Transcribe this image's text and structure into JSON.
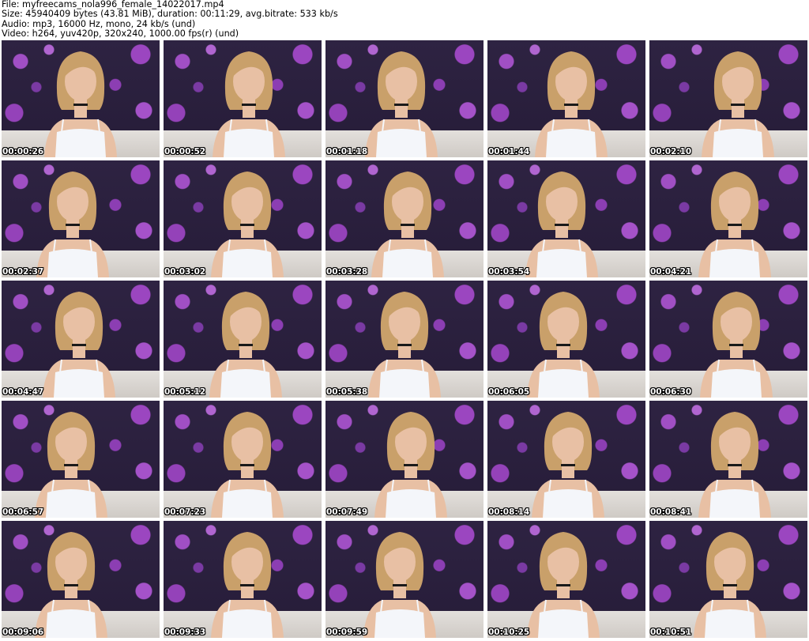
{
  "header": {
    "file_line": "File: myfreecams_nola996_female_14022017.mp4",
    "size_line": "Size: 45940409 bytes (43.81 MiB), duration: 00:11:29, avg.bitrate: 533 kb/s",
    "audio_line": "Audio: mp3, 16000 Hz, mono, 24 kb/s (und)",
    "video_line": "Video: h264, yuv420p, 320x240, 1000.00 fps(r) (und)"
  },
  "colors": {
    "wallpaper_base": "#2b2140",
    "flower_purple": "#a04fc4",
    "couch": "#dcd8d4",
    "top_white": "#f4f6fa",
    "hair": "#c9a06a",
    "skin": "#e8c0a4",
    "timestamp_text": "#ffffff"
  },
  "thumbnails": [
    {
      "time": "00:00:26"
    },
    {
      "time": "00:00:52"
    },
    {
      "time": "00:01:18"
    },
    {
      "time": "00:01:44"
    },
    {
      "time": "00:02:10"
    },
    {
      "time": "00:02:37"
    },
    {
      "time": "00:03:02"
    },
    {
      "time": "00:03:28"
    },
    {
      "time": "00:03:54"
    },
    {
      "time": "00:04:21"
    },
    {
      "time": "00:04:47"
    },
    {
      "time": "00:05:12"
    },
    {
      "time": "00:05:38"
    },
    {
      "time": "00:06:05"
    },
    {
      "time": "00:06:30"
    },
    {
      "time": "00:06:57"
    },
    {
      "time": "00:07:23"
    },
    {
      "time": "00:07:49"
    },
    {
      "time": "00:08:14"
    },
    {
      "time": "00:08:41"
    },
    {
      "time": "00:09:06"
    },
    {
      "time": "00:09:33"
    },
    {
      "time": "00:09:59"
    },
    {
      "time": "00:10:25"
    },
    {
      "time": "00:10:51"
    }
  ]
}
